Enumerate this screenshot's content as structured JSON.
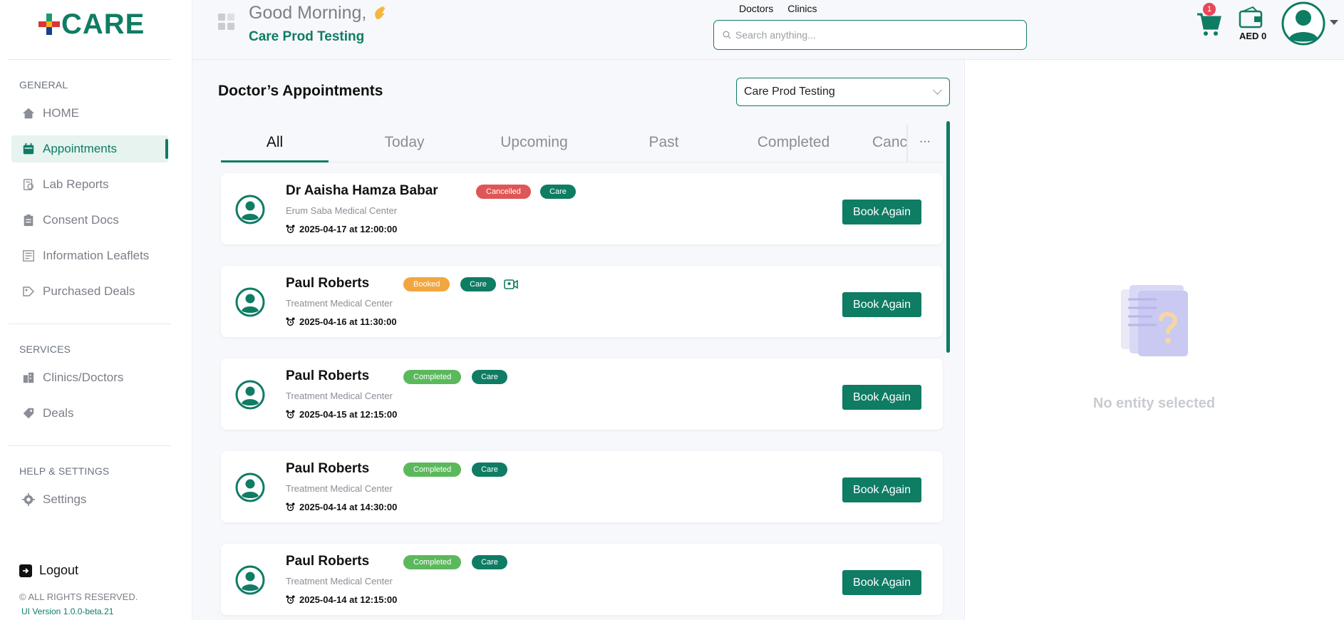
{
  "brand": {
    "name": "CARE"
  },
  "sidebar": {
    "sections": [
      {
        "title": "GENERAL"
      },
      {
        "title": "SERVICES"
      },
      {
        "title": "HELP & SETTINGS"
      }
    ],
    "items": [
      {
        "label": "HOME",
        "icon": "home-icon"
      },
      {
        "label": "Appointments",
        "icon": "calendar-icon",
        "active": true
      },
      {
        "label": "Lab Reports",
        "icon": "lab-report-icon"
      },
      {
        "label": "Consent Docs",
        "icon": "clipboard-icon"
      },
      {
        "label": "Information Leaflets",
        "icon": "leaflet-icon"
      },
      {
        "label": "Purchased Deals",
        "icon": "purchased-deals-icon"
      },
      {
        "label": "Clinics/Doctors",
        "icon": "building-icon"
      },
      {
        "label": "Deals",
        "icon": "tag-icon"
      },
      {
        "label": "Settings",
        "icon": "gear-icon"
      }
    ],
    "logout": "Logout",
    "rights": "© ALL RIGHTS RESERVED.",
    "version": "UI Version 1.0.0-beta.21"
  },
  "header": {
    "greeting": "Good Morning,",
    "user": "Care Prod Testing",
    "search_tabs": [
      "Doctors",
      "Clinics"
    ],
    "search_placeholder": "Search anything...",
    "cart_count": "1",
    "wallet": "AED 0"
  },
  "appointments": {
    "title": "Doctor’s Appointments",
    "clinic_filter": "Care Prod Testing",
    "tabs": [
      "All",
      "Today",
      "Upcoming",
      "Past",
      "Completed",
      "Cancelled"
    ],
    "active_tab": "All",
    "more": "···",
    "book_label": "Book Again",
    "care_label": "Care",
    "items": [
      {
        "doctor": "Dr Aaisha Hamza Babar",
        "clinic": "Erum Saba Medical Center",
        "datetime": "2025-04-17 at 12:00:00",
        "status": "Cancelled",
        "video": false
      },
      {
        "doctor": "Paul Roberts",
        "clinic": "Treatment Medical Center",
        "datetime": "2025-04-16 at 11:30:00",
        "status": "Booked",
        "video": true
      },
      {
        "doctor": "Paul Roberts",
        "clinic": "Treatment Medical Center",
        "datetime": "2025-04-15 at 12:15:00",
        "status": "Completed",
        "video": false
      },
      {
        "doctor": "Paul Roberts",
        "clinic": "Treatment Medical Center",
        "datetime": "2025-04-14 at 14:30:00",
        "status": "Completed",
        "video": false
      },
      {
        "doctor": "Paul Roberts",
        "clinic": "Treatment Medical Center",
        "datetime": "2025-04-14 at 12:15:00",
        "status": "Completed",
        "video": false
      }
    ]
  },
  "status_colors": {
    "Cancelled": "#de5655",
    "Booked": "#f2a640",
    "Completed": "#5cb85c"
  },
  "accent": "#0f7c64",
  "details": {
    "empty": "No entity selected"
  }
}
